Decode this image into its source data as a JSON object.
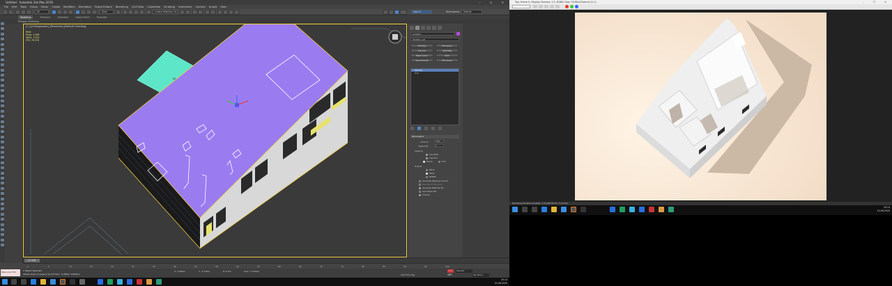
{
  "max": {
    "title": "Untitled - Autodesk 3ds Max 2019",
    "window_controls": "– ☐ ✕",
    "menus": [
      "File",
      "Edit",
      "Tools",
      "Group",
      "Views",
      "Create",
      "Modifiers",
      "Animation",
      "Graph Editors",
      "Rendering",
      "Civil View",
      "Customize",
      "Scripting",
      "Interactive",
      "Content",
      "Arnold",
      "Help"
    ],
    "toolbar": {
      "filter": "All",
      "view": "View",
      "selection_set": "Create Selection Se",
      "workspace_label": "Workspaces:",
      "workspace_value": "Default",
      "signin": "Sign In"
    },
    "ribbon_tabs": [
      "Modeling",
      "Freeform",
      "Selection",
      "Object Paint",
      "Populate"
    ],
    "ribbon_active": "Modeling",
    "ribbon_sub": "Polygon Modeling",
    "viewport": {
      "label": "[+] [Orthographic] [Standard] [Default Shading]",
      "stats": [
        "Total",
        "Polys:  1,948",
        "Verts:  1,914",
        "FPS:    76.378"
      ],
      "shadow_label": "Shadow"
    },
    "command_panel": {
      "object_name": "Line001",
      "modifier_list": "Modifier List",
      "buttons": [
        "Edit Poly",
        "Edit Spline",
        "Extrude",
        "UVW Map",
        "Mesh Select",
        "Shell",
        "TurboSmooth",
        "FFD 4x4x4"
      ],
      "stack": [
        "Extrude",
        "Line"
      ],
      "rollout": "Parameters",
      "amount_label": "Amount:",
      "amount_value": "3,2m",
      "segments_label": "Segments:",
      "segments_value": "1",
      "capping": "Capping",
      "cap_start": "Cap Start",
      "cap_end": "Cap End",
      "morph": "Morph",
      "grid": "Grid",
      "output": "Output",
      "patch": "Patch",
      "mesh": "Mesh",
      "nurbs": "NURBS",
      "gen_mapping": "Generate Mapping Coords.",
      "real_world": "Real-World Map Size",
      "gen_mat_ids": "Generate Material IDs",
      "use_shape_ids": "Use Shape IDs",
      "smooth": "Smooth"
    },
    "timeline": {
      "frame": "0 / 100",
      "ticks": [
        "0",
        "5",
        "10",
        "15",
        "20",
        "25",
        "30",
        "35",
        "40",
        "45",
        "50",
        "55",
        "60",
        "65",
        "70",
        "75",
        "80",
        "85",
        "90",
        "95",
        "100"
      ]
    },
    "status": {
      "maxscript": "Welcome  IT-IC",
      "line1": "1 Object Selected",
      "line2": "Vertex snap on Layer:0 at [70,72m, -5,280m, 0,000m]",
      "x_label": "X: 4,264m",
      "y_label": "Y: -3,776m",
      "z_label": "Z: 0,0m",
      "grid": "Grid = 0,254m",
      "add_time_tag": "Add Time Tag",
      "auto_key": "Auto Key",
      "selected": "Selected",
      "set_key": "Set Key",
      "key_filters": "Key Filters..."
    },
    "clock_time": "20:14",
    "clock_date": "10-06-2020"
  },
  "render": {
    "title": "Top, frame 0, Display Gamma: 2.2, RGBA Color 16 Bits/Channel (1:1)",
    "window_controls": "– ☐ ✕",
    "status": "Rendering finished  [Quality: 0.5]  [00:00:23 / 0:23:41]",
    "clock_time": "20:14",
    "clock_date": "10-06-2020"
  },
  "colors": {
    "roof": "#9a7cf0",
    "shadow_plane": "#5ee6c8",
    "selection": "#f4d03f",
    "render_bg": "#f5e4d2"
  }
}
